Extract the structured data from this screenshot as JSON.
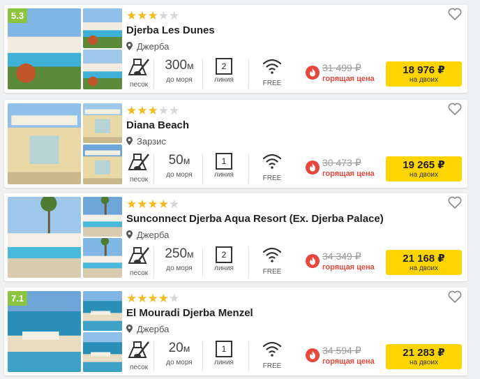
{
  "labels": {
    "sand": "песок",
    "to_sea": "до моря",
    "line": "линия",
    "wifi": "FREE",
    "hot_price": "горящая цена",
    "for_two": "на двоих"
  },
  "colors": {
    "accent_yellow": "#ffd500",
    "rating_green": "#8bc43f",
    "star": "#f5b921",
    "hot_red": "#e8473b"
  },
  "hotels": [
    {
      "rating": "5.3",
      "stars": "★★★",
      "stars_off": "★★",
      "name": "Djerba Les Dunes",
      "location": "Джерба",
      "distance": "300",
      "distance_unit": "м",
      "line": "2",
      "old_price": "31 499 ₽",
      "price": "18 976 ₽"
    },
    {
      "rating": "",
      "stars": "★★★",
      "stars_off": "★★",
      "name": "Diana Beach",
      "location": "Зарзис",
      "distance": "50",
      "distance_unit": "м",
      "line": "1",
      "old_price": "30 473 ₽",
      "price": "19 265 ₽"
    },
    {
      "rating": "",
      "stars": "★★★★",
      "stars_off": "★",
      "name": "Sunconnect Djerba Aqua Resort (Ex. Djerba Palace)",
      "location": "Джерба",
      "distance": "250",
      "distance_unit": "м",
      "line": "2",
      "old_price": "34 349 ₽",
      "price": "21 168 ₽"
    },
    {
      "rating": "7.1",
      "stars": "★★★★",
      "stars_off": "★",
      "name": "El Mouradi Djerba Menzel",
      "location": "Джерба",
      "distance": "20",
      "distance_unit": "м",
      "line": "1",
      "old_price": "34 594 ₽",
      "price": "21 283 ₽"
    }
  ]
}
